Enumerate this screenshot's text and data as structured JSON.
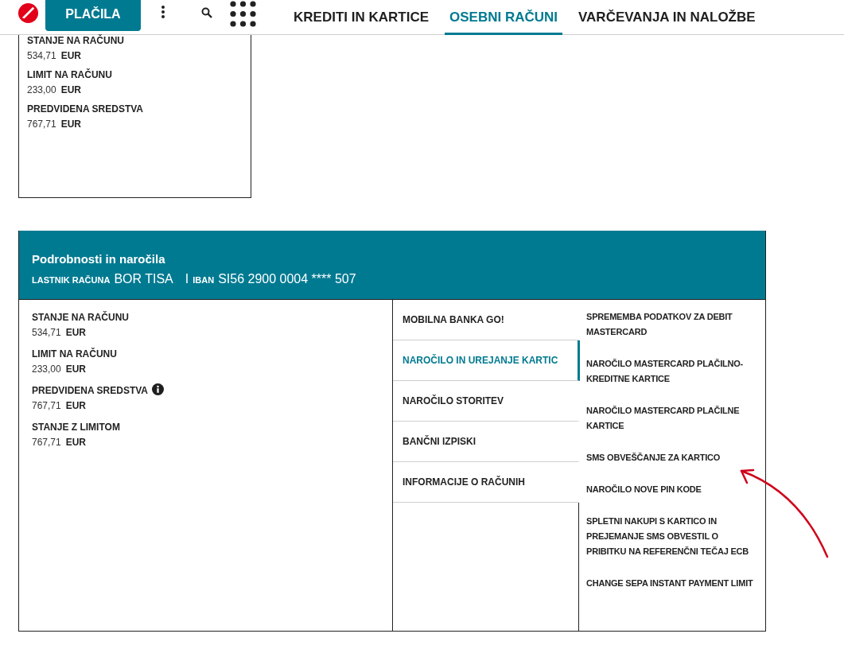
{
  "nav": {
    "primary_button": "PLAČILA",
    "tabs": [
      {
        "label": "KREDITI IN KARTICE",
        "selected": false
      },
      {
        "label": "OSEBNI RAČUNI",
        "selected": true
      },
      {
        "label": "VARČEVANJA IN NALOŽBE",
        "selected": false
      }
    ]
  },
  "summary_card": {
    "fields": [
      {
        "label": "STANJE NA RAČUNU",
        "amount": "534,71",
        "currency": "EUR"
      },
      {
        "label": "LIMIT NA RAČUNU",
        "amount": "233,00",
        "currency": "EUR"
      },
      {
        "label": "PREDVIDENA SREDSTVA",
        "amount": "767,71",
        "currency": "EUR"
      }
    ]
  },
  "details": {
    "title": "Podrobnosti in naročila",
    "owner_label": "LASTNIK RAČUNA",
    "owner": "BOR TISA",
    "separator": "I",
    "iban_label": "IBAN",
    "iban": "SI56 2900 0004 **** 507",
    "balances": [
      {
        "label": "STANJE NA RAČUNU",
        "amount": "534,71",
        "currency": "EUR",
        "info": false
      },
      {
        "label": "LIMIT NA RAČUNU",
        "amount": "233,00",
        "currency": "EUR",
        "info": false
      },
      {
        "label": "PREDVIDENA SREDSTVA",
        "amount": "767,71",
        "currency": "EUR",
        "info": true
      },
      {
        "label": "STANJE Z LIMITOM",
        "amount": "767,71",
        "currency": "EUR",
        "info": false
      }
    ],
    "menu": [
      {
        "label": "MOBILNA BANKA GO!",
        "selected": false
      },
      {
        "label": "NAROČILO IN UREJANJE KARTIC",
        "selected": true
      },
      {
        "label": "NAROČILO STORITEV",
        "selected": false
      },
      {
        "label": "BANČNI IZPISKI",
        "selected": false
      },
      {
        "label": "INFORMACIJE O RAČUNIH",
        "selected": false
      }
    ],
    "links": [
      "SPREMEMBA PODATKOV ZA DEBIT MASTERCARD",
      "NAROČILO MASTERCARD PLAČILNO-KREDITNE KARTICE",
      "NAROČILO MASTERCARD PLAČILNE KARTICE",
      "SMS OBVEŠČANJE ZA KARTICO",
      "NAROČILO NOVE PIN KODE",
      "SPLETNI NAKUPI S KARTICO IN PREJEMANJE SMS OBVESTIL O PRIBITKU NA REFERENČNI TEČAJ ECB",
      "CHANGE SEPA INSTANT PAYMENT LIMIT"
    ]
  }
}
